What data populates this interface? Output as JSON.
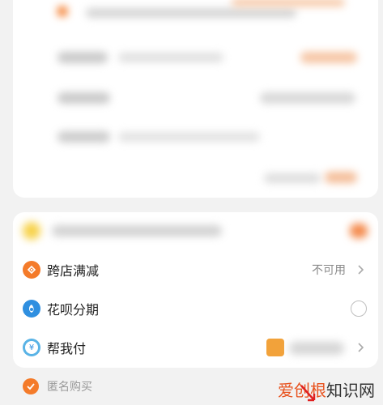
{
  "payment_options": {
    "items": [
      {
        "label": "跨店满减",
        "value": "不可用",
        "icon": "coupon-icon",
        "control": "chevron"
      },
      {
        "label": "花呗分期",
        "value": "",
        "icon": "huabei-icon",
        "control": "radio"
      },
      {
        "label": "帮我付",
        "value": "",
        "icon": "help-pay-icon",
        "control": "chevron"
      }
    ]
  },
  "footer": {
    "anonymous_label": "匿名购买"
  },
  "watermark": {
    "brand": "爱创根",
    "site": "知识网"
  },
  "colors": {
    "accent": "#f47b2a",
    "blue": "#2f8fe0",
    "background": "#f2f2f2"
  }
}
